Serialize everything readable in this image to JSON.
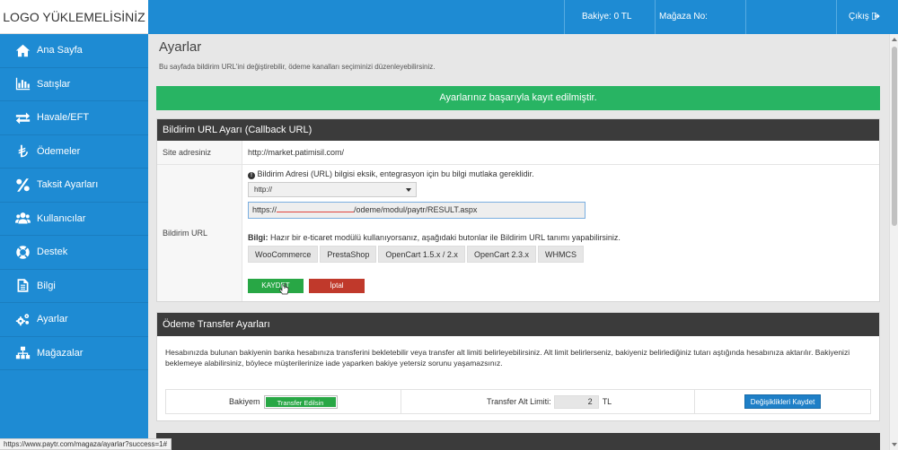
{
  "topbar": {
    "logo": "LOGO YÜKLEMELİSİNİZ",
    "balance": "Bakiye: 0 TL",
    "store_no": "Mağaza No:",
    "logout": "Çıkış"
  },
  "sidebar": {
    "items": [
      {
        "label": "Ana Sayfa",
        "icon": "home-icon"
      },
      {
        "label": "Satışlar",
        "icon": "bar-chart-icon"
      },
      {
        "label": "Havale/EFT",
        "icon": "transfer-arrows-icon"
      },
      {
        "label": "Ödemeler",
        "icon": "lira-icon"
      },
      {
        "label": "Taksit Ayarları",
        "icon": "percent-icon"
      },
      {
        "label": "Kullanıcılar",
        "icon": "users-icon"
      },
      {
        "label": "Destek",
        "icon": "lifebuoy-icon"
      },
      {
        "label": "Bilgi",
        "icon": "document-icon"
      },
      {
        "label": "Ayarlar",
        "icon": "gears-icon"
      },
      {
        "label": "Mağazalar",
        "icon": "sitemap-icon"
      }
    ]
  },
  "page": {
    "title": "Ayarlar",
    "subtitle": "Bu sayfada bildirim URL'ini değiştirebilir, ödeme kanalları seçiminizi düzenleyebilirsiniz."
  },
  "alert": {
    "message": "Ayarlarınız başarıyla kayıt edilmiştir."
  },
  "callback": {
    "header": "Bildirim URL Ayarı (Callback URL)",
    "site_label": "Site adresiniz",
    "site_value": "http://market.patimisil.com/",
    "url_label": "Bildirim URL",
    "warning": "Bildirim Adresi (URL) bilgisi eksik, entegrasyon için bu bilgi mutlaka gereklidir.",
    "protocol_value": "http://",
    "url_value_prefix": "https://",
    "url_value_suffix": "/odeme/modul/paytr/RESULT.aspx",
    "info_bold": "Bilgi:",
    "info_text": "Hazır bir e-ticaret modülü kullanıyorsanız, aşağıdaki butonlar ile Bildirim URL tanımı yapabilirsiniz.",
    "platforms": [
      "WooCommerce",
      "PrestaShop",
      "OpenCart 1.5.x / 2.x",
      "OpenCart 2.3.x",
      "WHMCS"
    ],
    "save_label": "KAYDET",
    "cancel_label": "İptal"
  },
  "transfer": {
    "header": "Ödeme Transfer Ayarları",
    "description": "Hesabınızda bulunan bakiyenin banka hesabınıza transferini bekletebilir veya transfer alt limiti belirleyebilirsiniz. Alt limit belirlerseniz, bakiyeniz belirlediğiniz tutarı aştığında hesabınıza aktarılır. Bakiyenizi beklemeye alabilirsiniz, böylece müşterilerinize iade yaparken bakiye yetersiz sorunu yaşamazsınız.",
    "balance_label": "Bakiyem",
    "toggle_label": "Transfer Edilsin",
    "limit_label": "Transfer Alt Limiti:",
    "limit_value": "2",
    "limit_unit": "TL",
    "save_changes_label": "Değişiklikleri Kaydet"
  },
  "statusbar": {
    "url": "https://www.paytr.com/magaza/ayarlar?success=1#"
  },
  "colors": {
    "primary": "#1e8bd3",
    "success": "#28b463",
    "danger": "#c0392b",
    "panel_header": "#3b3b3b"
  }
}
